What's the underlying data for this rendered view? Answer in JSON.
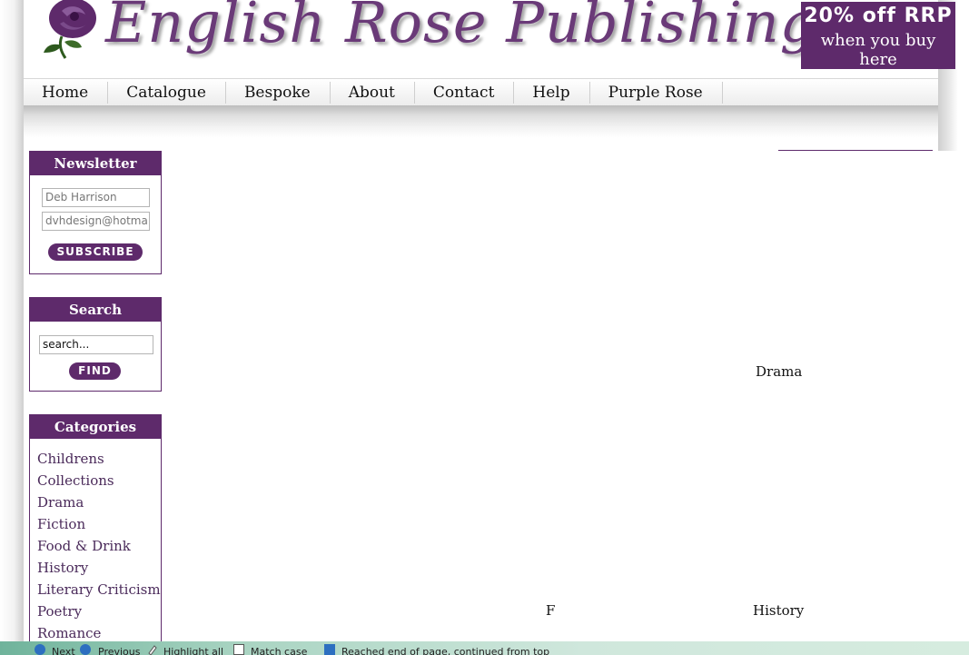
{
  "header": {
    "site_title": "English Rose Publishing",
    "promo_line1": "20% off RRP",
    "promo_line2": "when you buy here"
  },
  "nav": {
    "items": [
      "Home",
      "Catalogue",
      "Bespoke",
      "About",
      "Contact",
      "Help",
      "Purple Rose"
    ]
  },
  "newsletter": {
    "title": "Newsletter",
    "name_value": "Deb Harrison",
    "email_value": "dvhdesign@hotma",
    "subscribe_label": "SUBSCRIBE"
  },
  "search": {
    "title": "Search",
    "value": "search...",
    "find_label": "FIND"
  },
  "categories": {
    "title": "Categories",
    "items": [
      "Childrens",
      "Collections",
      "Drama",
      "Fiction",
      "Food & Drink",
      "History",
      "Literary Criticism",
      "Poetry",
      "Romance"
    ]
  },
  "main": {
    "label_drama": "Drama",
    "label_partial": "F",
    "label_history": "History"
  },
  "findbar": {
    "next": "Next",
    "previous": "Previous",
    "highlight_all": "Highlight all",
    "match_case": "Match case",
    "status": "Reached end of page, continued from top"
  },
  "colors": {
    "brand_purple": "#5e2a6b",
    "logo_purple": "#6a3a78",
    "findbar_green": "#a9d4c2"
  }
}
